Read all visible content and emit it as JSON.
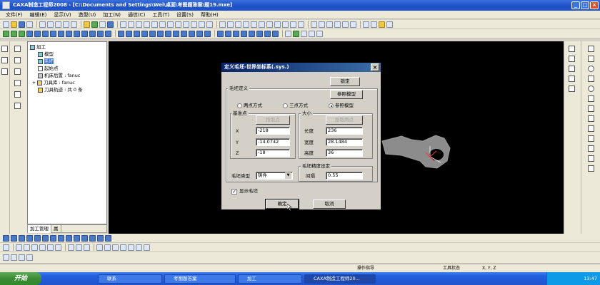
{
  "window": {
    "title": "CAXA制造工程师2008  - [C:\\Documents and Settings\\Wei\\桌面\\考图题答案\\题19.mxe]",
    "minimize": "_",
    "maximize": "□",
    "close": "×"
  },
  "menu": [
    "文件(F)",
    "编辑(E)",
    "显示(V)",
    "造型(U)",
    "加工(N)",
    "通信(C)",
    "工具(T)",
    "设置(S)",
    "帮助(H)"
  ],
  "tree": {
    "items": [
      {
        "label": "加工",
        "indent": 0
      },
      {
        "label": "模型",
        "indent": 1
      },
      {
        "label": "毛坯",
        "indent": 1,
        "selected": true
      },
      {
        "label": "起始点",
        "indent": 1
      },
      {
        "label": "机床后置 : fanuc",
        "indent": 1
      },
      {
        "label": "刀具库 : fanuc",
        "indent": 1
      },
      {
        "label": "刀具轨迹 : 共 0 条",
        "indent": 1
      }
    ],
    "tabs": [
      "加工管理",
      "属"
    ]
  },
  "dialog": {
    "title": "定义毛坯-世界坐标系(.sys.)",
    "lock_button": "锁定",
    "define_group": "毛坯定义",
    "ref_model_button": "参照模型",
    "radio_two_point": "两点方式",
    "radio_three_point": "三点方式",
    "radio_ref_model": "参照模型",
    "base_point_group": "基准点",
    "pick_point_button": "拾取点",
    "x_label": "X",
    "x_value": "-218",
    "y_label": "Y",
    "y_value": "-14.0742",
    "z_label": "Z",
    "z_value": "-18",
    "size_group": "大小",
    "pick_two_points_button": "拾取两点",
    "length_label": "长度",
    "length_value": "236",
    "width_label": "宽度",
    "width_value": "28.1484",
    "height_label": "高度",
    "height_value": "36",
    "blank_type_label": "毛坯类型",
    "blank_type_value": "铸件",
    "precision_group": "毛坯精度设定",
    "interval_label": "间隔",
    "interval_value": "0.55",
    "show_blank_label": "显示毛坯",
    "ok_button": "确定",
    "cancel_button": "取消"
  },
  "status": {
    "prompt": "操作指导",
    "tool_state": "工具状态",
    "coords": "X, Y, Z"
  },
  "taskbar": {
    "start": "开始",
    "tasks": [
      "联系",
      "考图题答案",
      "加工",
      "CAXA制造工程师20..."
    ],
    "clock": "13:47"
  },
  "colors": {
    "title_blue": "#1c4fc4",
    "canvas": "#000000",
    "dialog_title": "#0a246a",
    "taskbar": "#245edb"
  }
}
